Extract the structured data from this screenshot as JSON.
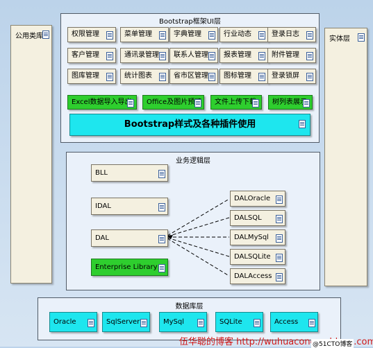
{
  "sides": {
    "left": "公用类库",
    "right": "实体层"
  },
  "ui": {
    "title": "Bootstrap框架UI层",
    "row1": [
      "权限管理",
      "菜单管理",
      "字典管理",
      "行业动态",
      "登录日志"
    ],
    "row2": [
      "客户管理",
      "通讯录管理",
      "联系人管理",
      "报表管理",
      "附件管理"
    ],
    "row3": [
      "图库管理",
      "统计图表",
      "省市区管理",
      "图标管理",
      "登录锁屏"
    ],
    "green": [
      "Excel数据导入导出",
      "Office及图片预览",
      "文件上传下载",
      "树列表展示"
    ],
    "banner": "Bootstrap样式及各种插件使用"
  },
  "bll": {
    "title": "业务逻辑层",
    "left": [
      "BLL",
      "IDAL",
      "DAL"
    ],
    "entlib": "Enterprise Library",
    "dal": [
      "DALOracle",
      "DALSQL",
      "DALMySql",
      "DALSQLite",
      "DALAccess"
    ]
  },
  "db": {
    "title": "数据库层",
    "items": [
      "Oracle",
      "SqlServer",
      "MySql",
      "SQLite",
      "Access"
    ]
  },
  "watermark": "伍华聪的博客  http://wuhuacong.cnblogs.com",
  "watermark2": "@51CTO博客"
}
